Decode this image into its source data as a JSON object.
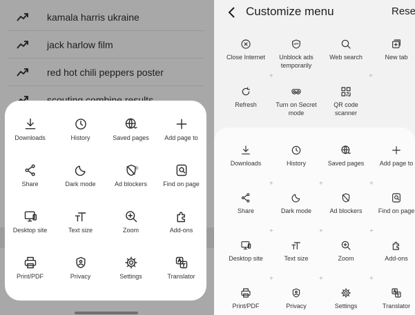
{
  "suggestions": [
    {
      "text": "kamala harris ukraine"
    },
    {
      "text": "jack harlow film"
    },
    {
      "text": "red hot chili peppers poster"
    },
    {
      "text": "scouting combine results"
    }
  ],
  "menu_sheet": {
    "items": [
      {
        "label": "Downloads",
        "icon": "download-icon"
      },
      {
        "label": "History",
        "icon": "history-icon"
      },
      {
        "label": "Saved pages",
        "icon": "saved-pages-icon"
      },
      {
        "label": "Add page to",
        "icon": "plus-icon"
      },
      {
        "label": "Share",
        "icon": "share-icon"
      },
      {
        "label": "Dark mode",
        "icon": "moon-icon"
      },
      {
        "label": "Ad blockers",
        "icon": "shield-icon"
      },
      {
        "label": "Find on page",
        "icon": "find-icon"
      },
      {
        "label": "Desktop site",
        "icon": "desktop-icon"
      },
      {
        "label": "Text size",
        "icon": "text-size-icon"
      },
      {
        "label": "Zoom",
        "icon": "zoom-icon"
      },
      {
        "label": "Add-ons",
        "icon": "puzzle-icon"
      },
      {
        "label": "Print/PDF",
        "icon": "printer-icon"
      },
      {
        "label": "Privacy",
        "icon": "privacy-icon"
      },
      {
        "label": "Settings",
        "icon": "gear-icon"
      },
      {
        "label": "Translator",
        "icon": "translate-icon"
      }
    ],
    "ad_blocker_count": "0"
  },
  "customize": {
    "title": "Customize menu",
    "reset_label": "Reset",
    "top_items": [
      {
        "label": "Close Internet",
        "icon": "close-circle-icon"
      },
      {
        "label": "Unblock ads temporarily",
        "icon": "unblock-ads-icon",
        "line1": "Unblock ads",
        "line2": "temporarily",
        "badge": "OFF"
      },
      {
        "label": "Web search",
        "icon": "search-icon"
      },
      {
        "label": "New tab",
        "icon": "new-tab-icon"
      },
      {
        "label": "Refresh",
        "icon": "refresh-icon"
      },
      {
        "label": "Turn on Secret mode",
        "icon": "secret-mode-icon",
        "line1": "Turn on Secret",
        "line2": "mode"
      },
      {
        "label": "QR code scanner",
        "icon": "qr-icon",
        "line1": "QR code",
        "line2": "scanner"
      }
    ],
    "grid_items": [
      {
        "label": "Downloads",
        "icon": "download-icon"
      },
      {
        "label": "History",
        "icon": "history-icon"
      },
      {
        "label": "Saved pages",
        "icon": "saved-pages-icon"
      },
      {
        "label": "Add page to",
        "icon": "plus-icon"
      },
      {
        "label": "Share",
        "icon": "share-icon"
      },
      {
        "label": "Dark mode",
        "icon": "moon-icon"
      },
      {
        "label": "Ad blockers",
        "icon": "shield-icon"
      },
      {
        "label": "Find on page",
        "icon": "find-icon"
      },
      {
        "label": "Desktop site",
        "icon": "desktop-icon"
      },
      {
        "label": "Text size",
        "icon": "text-size-icon"
      },
      {
        "label": "Zoom",
        "icon": "zoom-icon"
      },
      {
        "label": "Add-ons",
        "icon": "puzzle-icon"
      },
      {
        "label": "Print/PDF",
        "icon": "printer-icon"
      },
      {
        "label": "Privacy",
        "icon": "privacy-icon"
      },
      {
        "label": "Settings",
        "icon": "gear-icon"
      },
      {
        "label": "Translator",
        "icon": "translate-icon"
      }
    ]
  },
  "colors": {
    "overlay": "#a8a8a8",
    "sheet": "#ffffff",
    "right_background": "#f2f2f2",
    "icon_stroke": "#2b2b2b",
    "plus_marker": "#b3b3b3"
  }
}
